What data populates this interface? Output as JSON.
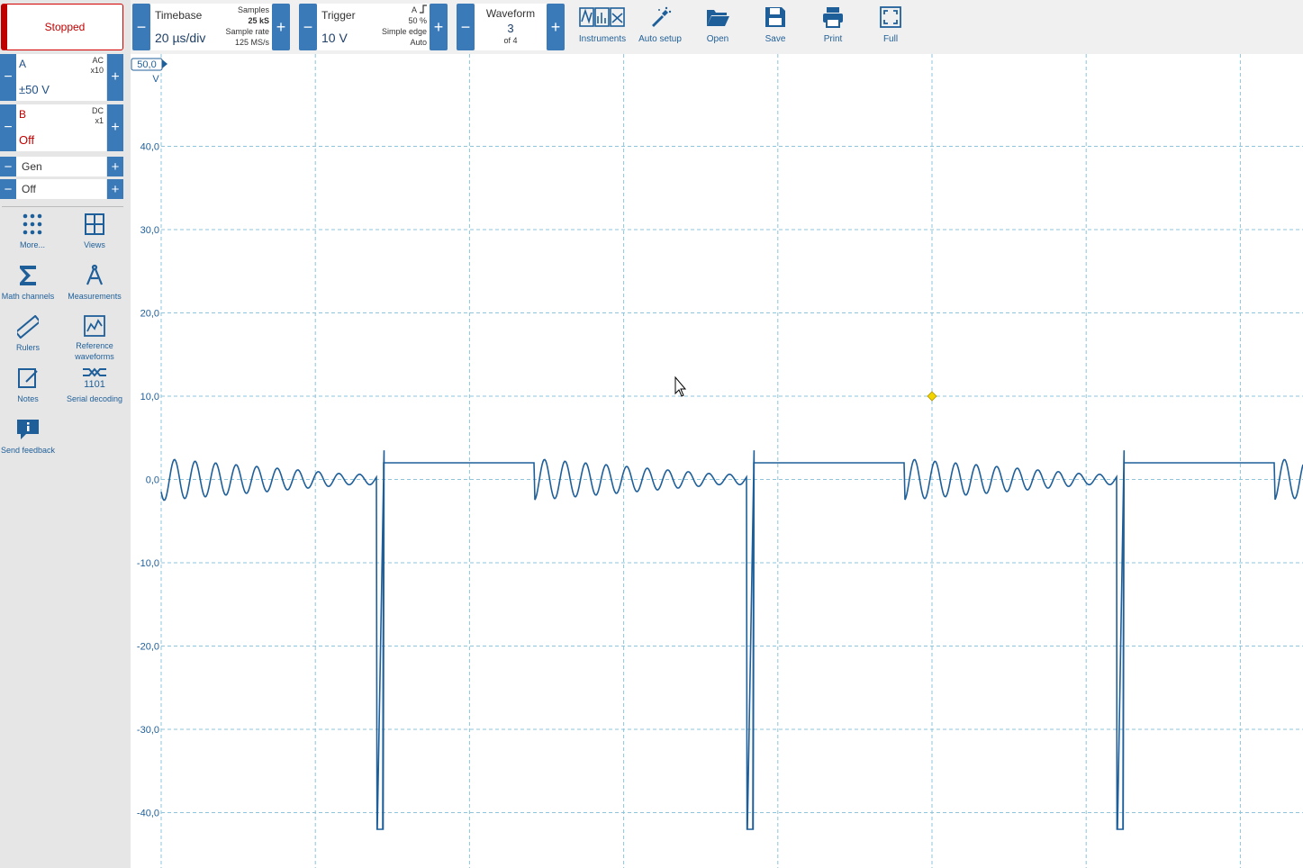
{
  "run_state": {
    "label": "Stopped"
  },
  "channels": [
    {
      "name": "A",
      "coupling": "AC",
      "probe": "x10",
      "range": "±50 V",
      "color": "#1f4f86"
    },
    {
      "name": "B",
      "coupling": "DC",
      "probe": "x1",
      "range": "Off",
      "color": "#c00000"
    }
  ],
  "generator": {
    "label": "Gen",
    "state": "Off"
  },
  "sidebar_tools": [
    {
      "label": "More...",
      "icon": "dots-grid-icon"
    },
    {
      "label": "Views",
      "icon": "views-grid-icon"
    },
    {
      "label": "Math channels",
      "icon": "sigma-icon"
    },
    {
      "label": "Measurements",
      "icon": "caliper-icon"
    },
    {
      "label": "Rulers",
      "icon": "ruler-icon"
    },
    {
      "label": "Reference waveforms",
      "icon": "reference-waveform-icon"
    },
    {
      "label": "Notes",
      "icon": "notes-icon"
    },
    {
      "label": "Serial decoding",
      "icon": "serial-decoding-icon",
      "glyph": "1101"
    },
    {
      "label": "Send feedback",
      "icon": "feedback-icon"
    }
  ],
  "timebase": {
    "title": "Timebase",
    "value": "20 µs/div",
    "samples_label": "Samples",
    "samples": "25 kS",
    "rate_label": "Sample rate",
    "rate": "125 MS/s"
  },
  "trigger": {
    "title": "Trigger",
    "value": "10 V",
    "source": "A",
    "level_pct": "50 %",
    "type": "Simple edge",
    "mode": "Auto"
  },
  "waveform": {
    "title": "Waveform",
    "current": "3",
    "total": "of 4"
  },
  "toolbar": [
    {
      "label": "Instruments",
      "icon": "instruments-icon"
    },
    {
      "label": "Auto setup",
      "icon": "auto-setup-icon"
    },
    {
      "label": "Open",
      "icon": "folder-open-icon"
    },
    {
      "label": "Save",
      "icon": "save-icon"
    },
    {
      "label": "Print",
      "icon": "print-icon"
    },
    {
      "label": "Full",
      "icon": "fullscreen-icon"
    }
  ],
  "chart_data": {
    "type": "line",
    "unit": "V",
    "ylim": [
      -50,
      50
    ],
    "y_top_label": "50,0",
    "yticks": [
      "40,0",
      "30,0",
      "20,0",
      "10,0",
      "0,0",
      "-10,0",
      "-20,0",
      "-30,0",
      "-40,0"
    ],
    "ytick_values": [
      40,
      30,
      20,
      10,
      0,
      -10,
      -20,
      -30,
      -40
    ],
    "x_divisions": 10,
    "grid": true,
    "trigger_marker": {
      "value": 10
    },
    "series": [
      {
        "color": "#1f5f99",
        "pulse_period_div": 2.4,
        "pulse_starts_div": [
          1.4,
          3.8,
          6.2
        ],
        "pulse_width_div": 0.04,
        "pulse_low": -42,
        "high_level": 2,
        "ring_amplitude": 2.5,
        "ring_center": 0,
        "ring_cycles_per_div": 7.5
      }
    ]
  }
}
